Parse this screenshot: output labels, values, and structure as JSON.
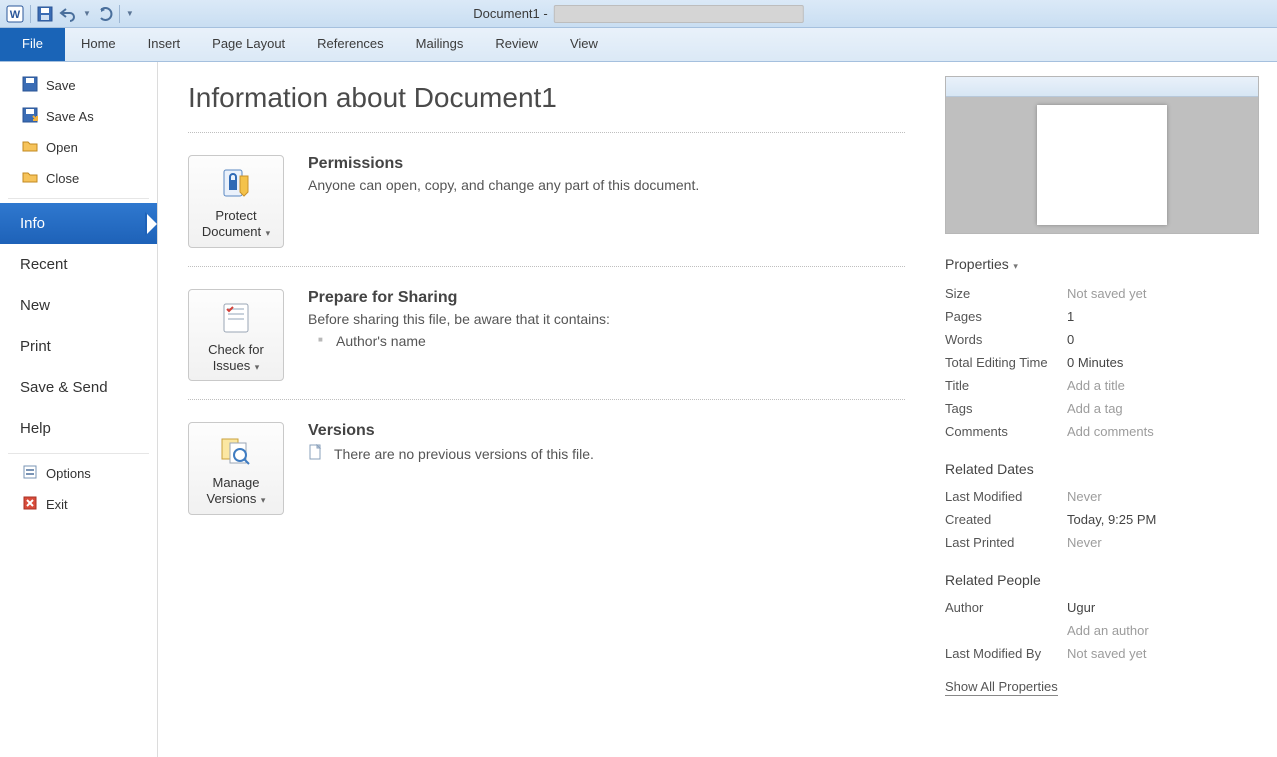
{
  "titlebar": {
    "document_name": "Document1 -"
  },
  "ribbon": {
    "tabs": [
      "File",
      "Home",
      "Insert",
      "Page Layout",
      "References",
      "Mailings",
      "Review",
      "View"
    ]
  },
  "sidebar": {
    "save": "Save",
    "save_as": "Save As",
    "open": "Open",
    "close": "Close",
    "info": "Info",
    "recent": "Recent",
    "new": "New",
    "print": "Print",
    "save_send": "Save & Send",
    "help": "Help",
    "options": "Options",
    "exit": "Exit"
  },
  "page": {
    "title": "Information about Document1",
    "permissions": {
      "heading": "Permissions",
      "desc": "Anyone can open, copy, and change any part of this document.",
      "button": "Protect Document"
    },
    "sharing": {
      "heading": "Prepare for Sharing",
      "desc": "Before sharing this file, be aware that it contains:",
      "items": [
        "Author's name"
      ],
      "button": "Check for Issues"
    },
    "versions": {
      "heading": "Versions",
      "desc": "There are no previous versions of this file.",
      "button": "Manage Versions"
    }
  },
  "properties": {
    "header": "Properties",
    "rows": {
      "size_k": "Size",
      "size_v": "Not saved yet",
      "pages_k": "Pages",
      "pages_v": "1",
      "words_k": "Words",
      "words_v": "0",
      "editing_k": "Total Editing Time",
      "editing_v": "0 Minutes",
      "title_k": "Title",
      "title_v": "Add a title",
      "tags_k": "Tags",
      "tags_v": "Add a tag",
      "comments_k": "Comments",
      "comments_v": "Add comments"
    },
    "dates_header": "Related Dates",
    "dates": {
      "modified_k": "Last Modified",
      "modified_v": "Never",
      "created_k": "Created",
      "created_v": "Today, 9:25 PM",
      "printed_k": "Last Printed",
      "printed_v": "Never"
    },
    "people_header": "Related People",
    "people": {
      "author_k": "Author",
      "author_v": "Ugur",
      "author_add": "Add an author",
      "lastmod_k": "Last Modified By",
      "lastmod_v": "Not saved yet"
    },
    "show_all": "Show All Properties"
  }
}
